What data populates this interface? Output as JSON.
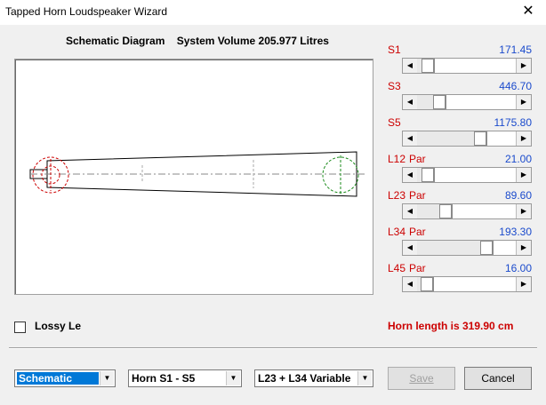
{
  "window": {
    "title": "Tapped Horn Loudspeaker Wizard",
    "close_glyph": "✕"
  },
  "schematic": {
    "heading": "Schematic Diagram",
    "system_volume": "System Volume 205.977 Litres"
  },
  "params": [
    {
      "name": "S1",
      "suffix": "",
      "value": "171.45",
      "position": 0.05
    },
    {
      "name": "S3",
      "suffix": "",
      "value": "446.70",
      "position": 0.18
    },
    {
      "name": "S5",
      "suffix": "",
      "value": "1175.80",
      "position": 0.65
    },
    {
      "name": "L12",
      "suffix": "Par",
      "value": "21.00",
      "position": 0.05
    },
    {
      "name": "L23",
      "suffix": "Par",
      "value": "89.60",
      "position": 0.25
    },
    {
      "name": "L34",
      "suffix": "Par",
      "value": "193.30",
      "position": 0.72
    },
    {
      "name": "L45",
      "suffix": "Par",
      "value": "16.00",
      "position": 0.04
    }
  ],
  "lossy": {
    "label": "Lossy Le",
    "checked": false
  },
  "horn_length": "Horn length is 319.90 cm",
  "combos": {
    "view": "Schematic",
    "range": "Horn S1 - S5",
    "mode": "L23 + L34 Variable"
  },
  "buttons": {
    "save": "Save",
    "cancel": "Cancel"
  },
  "colors": {
    "label_red": "#cc0000",
    "value_blue": "#1a4acc",
    "selection": "#0078d7",
    "driver_red": "#cc0000",
    "port_green": "#1a8a1a"
  }
}
